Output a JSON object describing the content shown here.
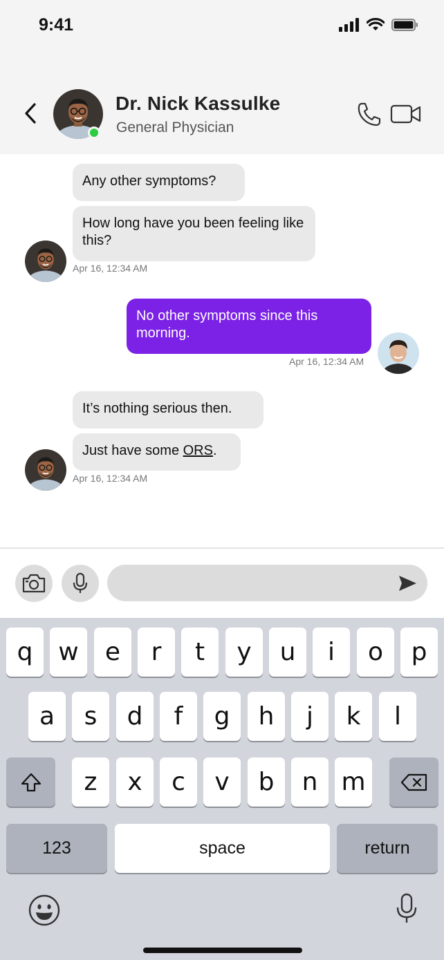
{
  "status_bar": {
    "time": "9:41"
  },
  "header": {
    "name": "Dr. Nick Kassulke",
    "title": "General Physician",
    "online": true
  },
  "messages": [
    {
      "sender": "doctor",
      "text": "Any other symptoms?"
    },
    {
      "sender": "doctor",
      "text": "How long have you been feeling like this?",
      "timestamp": "Apr 16, 12:34 AM"
    },
    {
      "sender": "user",
      "text": "No other symptoms since this morning.",
      "timestamp": "Apr 16, 12:34 AM"
    },
    {
      "sender": "doctor",
      "text": "It’s nothing serious then."
    },
    {
      "sender": "doctor",
      "text_before": "Just have some ",
      "link": "ORS",
      "text_after": ".",
      "timestamp": "Apr 16, 12:34 AM"
    }
  ],
  "composer": {
    "value": "",
    "placeholder": ""
  },
  "keyboard": {
    "row1": [
      "q",
      "w",
      "e",
      "r",
      "t",
      "y",
      "u",
      "i",
      "o",
      "p"
    ],
    "row2": [
      "a",
      "s",
      "d",
      "f",
      "g",
      "h",
      "j",
      "k",
      "l"
    ],
    "row3": [
      "z",
      "x",
      "c",
      "v",
      "b",
      "n",
      "m"
    ],
    "numbers_label": "123",
    "space_label": "space",
    "return_label": "return"
  },
  "colors": {
    "accent": "#7b22e6",
    "incoming_bubble": "#e9e9e9",
    "online": "#2ecc40"
  },
  "icons": [
    "back-chevron-icon",
    "phone-icon",
    "video-camera-icon",
    "camera-icon",
    "microphone-icon",
    "send-icon",
    "shift-icon",
    "backspace-icon",
    "emoji-icon",
    "dictation-icon"
  ]
}
